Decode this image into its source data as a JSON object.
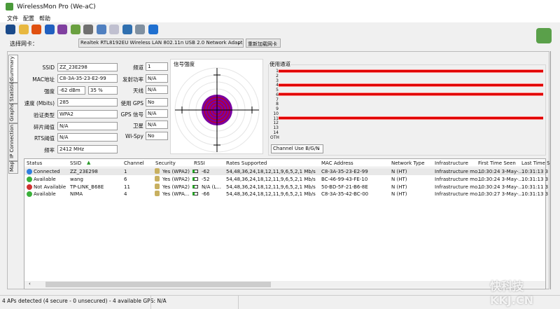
{
  "window": {
    "title": "WirelessMon Pro (We-aC)"
  },
  "menu": [
    "文件",
    "配置",
    "帮助"
  ],
  "toolbar_icons": [
    "save-icon",
    "open-folder-icon",
    "record-icon",
    "network-icon",
    "network-alt-icon",
    "export-icon",
    "print-icon",
    "check-icon",
    "clipboard-icon",
    "globe-icon",
    "info-globe-icon",
    "help-icon"
  ],
  "adapter": {
    "label": "选择网卡：",
    "value": "Realtek RTL8192EU Wireless LAN 802.11n USB 2.0 Network Adapter",
    "reload": "重新加载网卡"
  },
  "tabs": [
    "Summary",
    "Statistics",
    "Graphs",
    "IP Connection",
    "Map"
  ],
  "summary": {
    "left": [
      {
        "label": "SSID",
        "value": "ZZ_23E298"
      },
      {
        "label": "MAC地址",
        "value": "C8-3A-35-23-E2-99"
      },
      {
        "label": "强度",
        "value": "-62 dBm",
        "value2": "35 %"
      },
      {
        "label": "速度 (Mbits)",
        "value": "285"
      },
      {
        "label": "验证类型",
        "value": "WPA2"
      },
      {
        "label": "碎片阈值",
        "value": "N/A"
      },
      {
        "label": "RTS阈值",
        "value": "N/A"
      },
      {
        "label": "频率",
        "value": "2412 MHz"
      }
    ],
    "right": [
      {
        "label": "频道",
        "value": "1"
      },
      {
        "label": "发射功率",
        "value": "N/A"
      },
      {
        "label": "天线",
        "value": "N/A"
      },
      {
        "label": "使用 GPS",
        "value": "No"
      },
      {
        "label": "GPS 信号",
        "value": "N/A"
      },
      {
        "label": "卫星",
        "value": "N/A"
      },
      {
        "label": "Wi-Spy",
        "value": "No"
      }
    ]
  },
  "signal": {
    "title": "信号强度",
    "percent": 35
  },
  "channels": {
    "title": "使用通道",
    "labels": [
      "1",
      "2",
      "3",
      "4",
      "5",
      "6",
      "7",
      "8",
      "9",
      "10",
      "11",
      "12",
      "13",
      "14",
      "OTH"
    ],
    "used": [
      "1",
      "4",
      "6",
      "11"
    ],
    "mode": "Channel Use B/G/N",
    "bar_color": "#e00000"
  },
  "table": {
    "columns": [
      "Status",
      "SSID",
      "Channel",
      "Security",
      "RSSI",
      "Rates Supported",
      "MAC Address",
      "Network Type",
      "Infrastructure",
      "First Time Seen",
      "Last Time S"
    ],
    "rows": [
      {
        "status": "Connected",
        "color": "#2f7fe0",
        "ssid": "ZZ_23E298",
        "channel": "1",
        "security": "Yes (WPA2)",
        "rssi": "-62",
        "rates": "54,48,36,24,18,12,11,9,6,5,2,1 Mb/s",
        "mac": "C8-3A-35-23-E2-99",
        "type": "N (HT)",
        "infra": "Infrastructure mo...",
        "first": "10:30:24 3-May-...",
        "last": "10:31:13 3"
      },
      {
        "status": "Available",
        "color": "#3ab03a",
        "ssid": "wang",
        "channel": "6",
        "security": "Yes (WPA2)",
        "rssi": "-52",
        "rates": "54,48,36,24,18,12,11,9,6,5,2,1 Mb/s",
        "mac": "BC-46-99-43-FE-10",
        "type": "N (HT)",
        "infra": "Infrastructure mo...",
        "first": "10:30:24 3-May-...",
        "last": "10:31:13 3"
      },
      {
        "status": "Not Available",
        "color": "#d03030",
        "ssid": "TP-LINK_B68E",
        "channel": "11",
        "security": "Yes (WPA2)",
        "rssi": "N/A (L...",
        "rates": "54,48,36,24,18,12,11,9,6,5,2,1 Mb/s",
        "mac": "50-BD-5F-21-B6-8E",
        "type": "N (HT)",
        "infra": "Infrastructure mo...",
        "first": "10:30:24 3-May-...",
        "last": "10:31:11 3"
      },
      {
        "status": "Available",
        "color": "#3ab03a",
        "ssid": "NIMA",
        "channel": "4",
        "security": "Yes (WPA...",
        "rssi": "-66",
        "rates": "54,48,36,24,18,12,11,9,6,5,2,1 Mb/s",
        "mac": "C8-3A-35-42-BC-00",
        "type": "N (HT)",
        "infra": "Infrastructure mo...",
        "first": "10:30:27 3-May-...",
        "last": "10:31:13 3"
      }
    ]
  },
  "statusbar": {
    "text": "4 APs detected (4 secure - 0 unsecured) - 4 available GPS: N/A"
  },
  "watermark": "快科技 KKJ.CN"
}
